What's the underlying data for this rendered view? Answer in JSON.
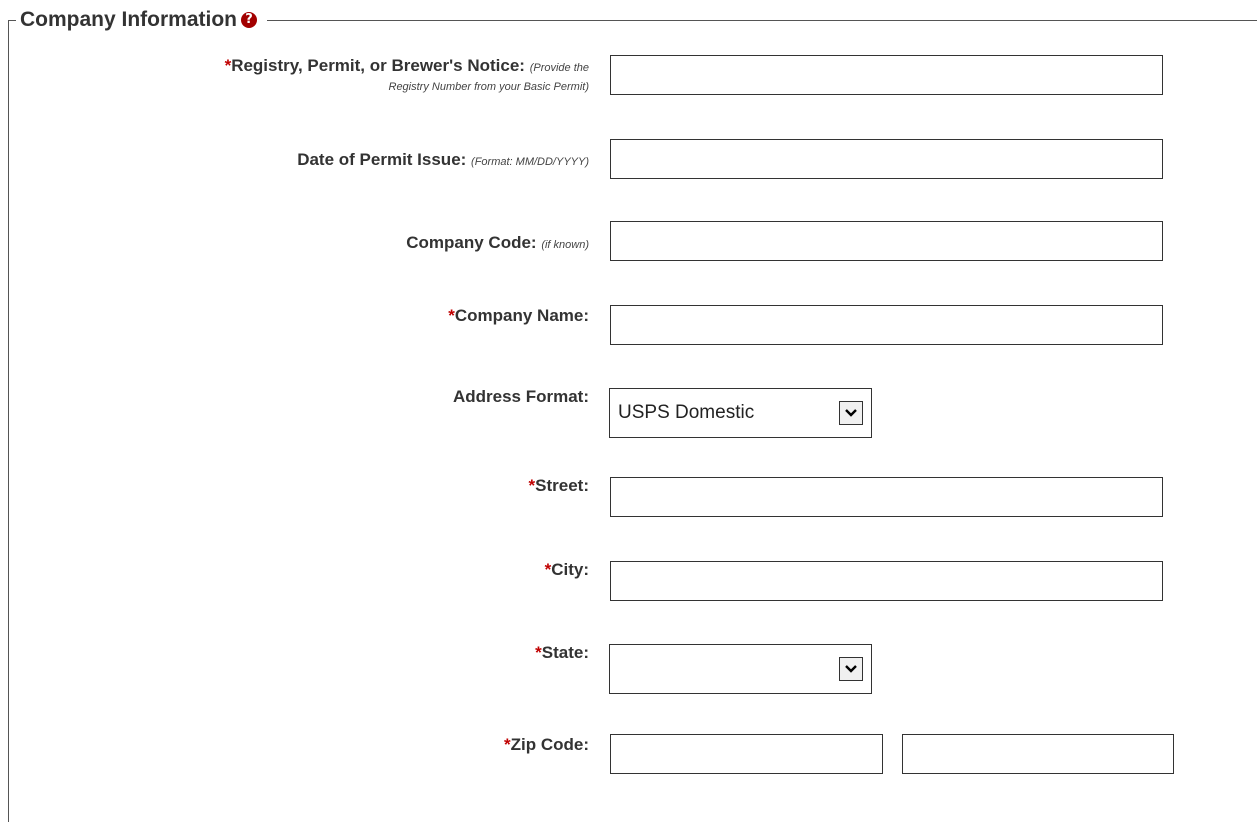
{
  "section": {
    "title": "Company Information",
    "help_glyph": "?"
  },
  "fields": {
    "registry": {
      "required_mark": "*",
      "label": "Registry, Permit, or Brewer's Notice:",
      "hint_line1": "(Provide the",
      "hint_line2": "Registry Number from your Basic Permit)",
      "value": ""
    },
    "permit_date": {
      "label": "Date of Permit Issue:",
      "hint": "(Format: MM/DD/YYYY)",
      "value": ""
    },
    "company_code": {
      "label": "Company Code:",
      "hint": "(if known)",
      "value": ""
    },
    "company_name": {
      "required_mark": "*",
      "label": "Company Name:",
      "value": ""
    },
    "address_format": {
      "label": "Address Format:",
      "selected": "USPS Domestic"
    },
    "street": {
      "required_mark": "*",
      "label": "Street:",
      "value": ""
    },
    "city": {
      "required_mark": "*",
      "label": "City:",
      "value": ""
    },
    "state": {
      "required_mark": "*",
      "label": "State:",
      "selected": ""
    },
    "zip": {
      "required_mark": "*",
      "label": "Zip Code:",
      "value": "",
      "extension_value": ""
    }
  },
  "icons": {
    "help": "help-icon",
    "dropdown": "chevron-down-icon"
  },
  "colors": {
    "required": "#c00000",
    "help_icon": "#a30000",
    "label_text": "#333333",
    "border": "#333333"
  }
}
